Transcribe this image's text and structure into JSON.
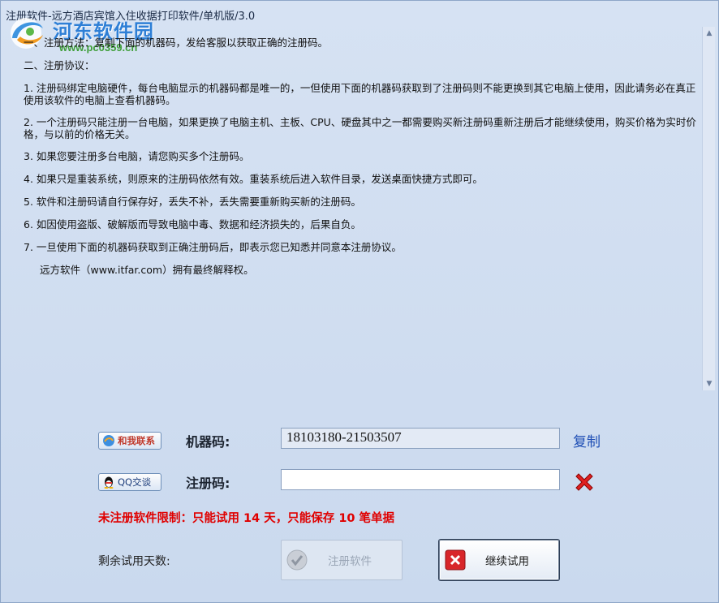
{
  "window": {
    "title": "注册软件-远方酒店宾馆入住收据打印软件/单机版/3.0"
  },
  "watermark": {
    "name": "河东软件园",
    "url": "www.pc0359.cn"
  },
  "agreement": {
    "paragraphs": [
      "一、注册方法：复制下面的机器码，发给客服以获取正确的注册码。",
      "二、注册协议：",
      "1. 注册码绑定电脑硬件，每台电脑显示的机器码都是唯一的，一但使用下面的机器码获取到了注册码则不能更换到其它电脑上使用，因此请务必在真正使用该软件的电脑上查看机器码。",
      "2. 一个注册码只能注册一台电脑，如果更换了电脑主机、主板、CPU、硬盘其中之一都需要购买新注册码重新注册后才能继续使用，购买价格为实时价格，与以前的价格无关。",
      "3. 如果您要注册多台电脑，请您购买多个注册码。",
      "4. 如果只是重装系统，则原来的注册码依然有效。重装系统后进入软件目录，发送桌面快捷方式即可。",
      "5. 软件和注册码请自行保存好，丢失不补，丢失需要重新购买新的注册码。",
      "6. 如因使用盗版、破解版而导致电脑中毒、数据和经济损失的，后果自负。",
      "7. 一旦使用下面的机器码获取到正确注册码后，即表示您已知悉并同意本注册协议。",
      "远方软件（www.itfar.com）拥有最终解释权。"
    ]
  },
  "contact": {
    "contact_us_label": "和我联系",
    "qq_label": "QQ交谈"
  },
  "machine_code": {
    "label": "机器码:",
    "value": "18103180-21503507",
    "copy_label": "复制"
  },
  "reg_code": {
    "label": "注册码:",
    "value": "",
    "placeholder": ""
  },
  "limit_text": "未注册软件限制：只能试用 14 天，只能保存 10 笔单据",
  "remaining_label": "剩余试用天数:",
  "buttons": {
    "register": "注册软件",
    "continue": "继续试用"
  },
  "colors": {
    "limit_red": "#e00000",
    "link_blue": "#1f4fb5",
    "window_bg": "#cfdcef"
  }
}
